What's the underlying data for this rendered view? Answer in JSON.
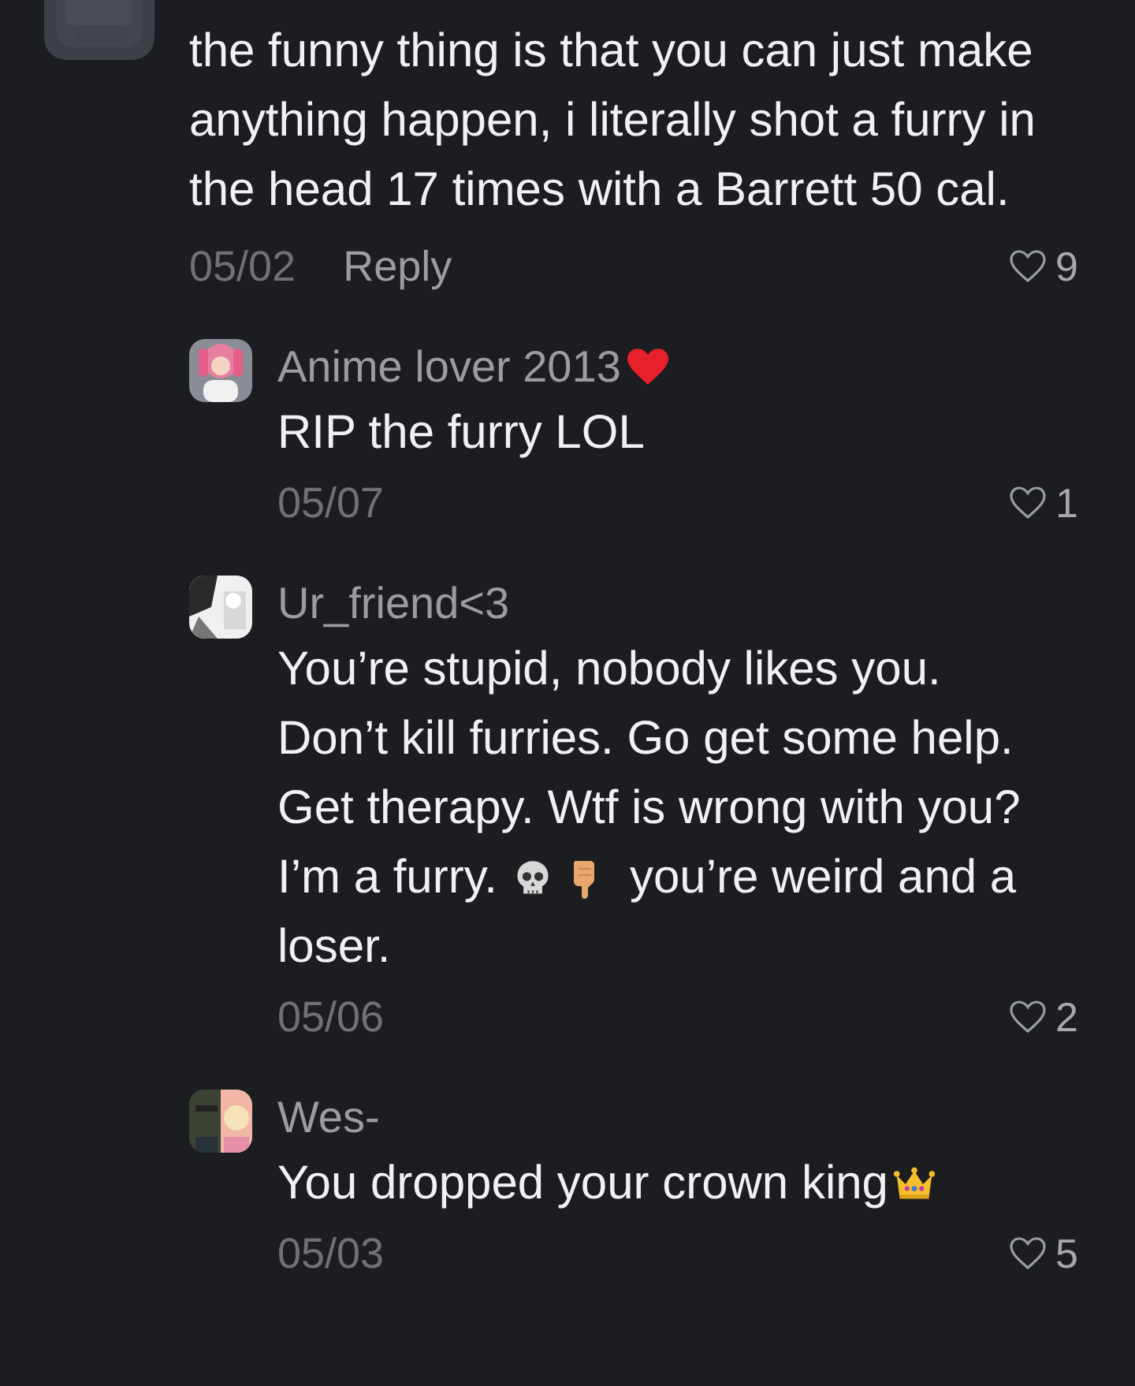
{
  "comment": {
    "avatar": {
      "kind": "picture"
    },
    "text": "the funny thing is that you can just make anything happen, i literally shot a furry in the head 17 times with a Barrett 50 cal.",
    "date": "05/02",
    "reply": "Reply",
    "likes": "9",
    "liked": false
  },
  "replies": [
    {
      "avatar": {
        "kind": "picture"
      },
      "name": [
        {
          "kind": "text",
          "text": "Anime lover 2013"
        },
        {
          "kind": "heart"
        }
      ],
      "body": [
        [
          {
            "kind": "text",
            "text": "RIP the furry LOL"
          }
        ]
      ],
      "date": "05/07",
      "likes": "1",
      "liked": false
    },
    {
      "avatar": {
        "kind": "picture"
      },
      "name": [
        {
          "kind": "text",
          "text": "Ur_friend<3"
        }
      ],
      "body": [
        [
          {
            "kind": "text",
            "text": "You’re stupid, nobody likes you."
          }
        ],
        [
          {
            "kind": "text",
            "text": "Don’t kill furries. Go get some help."
          }
        ],
        [
          {
            "kind": "text",
            "text": "Get therapy. Wtf is wrong with you?"
          }
        ],
        [
          {
            "kind": "text",
            "text": "I’m a furry."
          },
          {
            "kind": "skull"
          },
          {
            "kind": "thumbs-down"
          },
          {
            "kind": "text",
            "text": "you’re weird and a"
          }
        ],
        [
          {
            "kind": "text",
            "text": "loser."
          }
        ]
      ],
      "date": "05/06",
      "likes": "2",
      "liked": false
    },
    {
      "avatar": {
        "kind": "picture"
      },
      "name": [
        {
          "kind": "text",
          "text": "Wes-"
        }
      ],
      "body": [
        [
          {
            "kind": "text",
            "text": "You dropped your crown king"
          },
          {
            "kind": "crown"
          }
        ]
      ],
      "date": "05/03",
      "likes": "5",
      "liked": false
    }
  ]
}
